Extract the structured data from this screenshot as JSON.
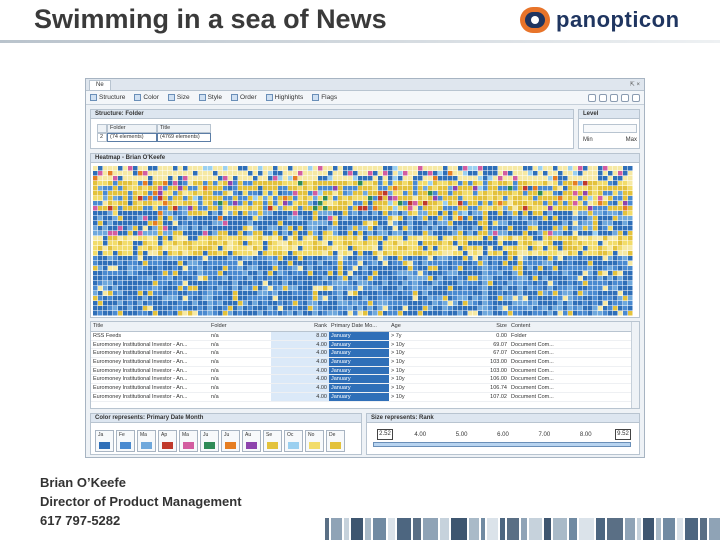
{
  "slide": {
    "title": "Swimming in a sea of News",
    "logo_text": "panopticon",
    "presenter": {
      "name": "Brian O’Keefe",
      "role": "Director of Product Management",
      "phone": "617 797-5282"
    }
  },
  "app": {
    "tab_label": "Ne",
    "window_controls": "⇱ ×",
    "toolbar": {
      "items": [
        {
          "label": "Structure",
          "icon": "structure-icon"
        },
        {
          "label": "Color",
          "icon": "color-icon"
        },
        {
          "label": "Size",
          "icon": "size-icon"
        },
        {
          "label": "Style",
          "icon": "style-icon"
        },
        {
          "label": "Order",
          "icon": "order-icon"
        },
        {
          "label": "Highlights",
          "icon": "highlights-icon"
        },
        {
          "label": "Flags",
          "icon": "flags-icon"
        }
      ]
    },
    "structure_panel": {
      "header": "Structure: Folder",
      "columns": [
        "Folder",
        "Title"
      ],
      "row_number": "2",
      "row_values": [
        "(74 elements)",
        "(4769 elements)"
      ]
    },
    "level_panel": {
      "header": "Level",
      "min_label": "Min",
      "max_label": "Max"
    },
    "heatmap_panel": {
      "header": "Heatmap - Brian O'Keefe",
      "colors": [
        "#2f6fb8",
        "#4a8ad0",
        "#e3c23c",
        "#f2dc6a",
        "#f6e9a4",
        "#6fa8dc",
        "#c0392b",
        "#2e8b57",
        "#8e44ad",
        "#e67e22",
        "#d35da0",
        "#9bd0f0"
      ]
    },
    "table": {
      "columns": [
        "Title",
        "Folder",
        "Rank",
        "Primary Date Mo...",
        "Age",
        "Size",
        "Content"
      ],
      "rows": [
        [
          "RSS Feeds",
          "n/a",
          "8.00",
          "January",
          "> 7y",
          "0.00",
          "Folder"
        ],
        [
          "Euromoney Institutional Investor - An...",
          "n/a",
          "4.00",
          "January",
          "> 10y",
          "69.07",
          "Document Com..."
        ],
        [
          "Euromoney Institutional Investor - An...",
          "n/a",
          "4.00",
          "January",
          "> 10y",
          "67.07",
          "Document Com..."
        ],
        [
          "Euromoney Institutional Investor - An...",
          "n/a",
          "4.00",
          "January",
          "> 10y",
          "103.00",
          "Document Com..."
        ],
        [
          "Euromoney Institutional Investor - An...",
          "n/a",
          "4.00",
          "January",
          "> 10y",
          "103.00",
          "Document Com..."
        ],
        [
          "Euromoney Institutional Investor - An...",
          "n/a",
          "4.00",
          "January",
          "> 10y",
          "106.00",
          "Document Com..."
        ],
        [
          "Euromoney Institutional Investor - An...",
          "n/a",
          "4.00",
          "January",
          "> 10y",
          "106.74",
          "Document Com..."
        ],
        [
          "Euromoney Institutional Investor - An...",
          "n/a",
          "4.00",
          "January",
          "> 10y",
          "107.02",
          "Document Com..."
        ]
      ]
    },
    "color_panel": {
      "header": "Color represents: Primary Date Month",
      "items": [
        {
          "label": "Ja",
          "color": "#2f6fb8"
        },
        {
          "label": "Fe",
          "color": "#4a8ad0"
        },
        {
          "label": "Ma",
          "color": "#6fa8dc"
        },
        {
          "label": "Ap",
          "color": "#c0392b"
        },
        {
          "label": "Ma",
          "color": "#d35da0"
        },
        {
          "label": "Ju",
          "color": "#2e8b57"
        },
        {
          "label": "Ju",
          "color": "#e67e22"
        },
        {
          "label": "Au",
          "color": "#8e44ad"
        },
        {
          "label": "Se",
          "color": "#e3c23c"
        },
        {
          "label": "Oc",
          "color": "#9bd0f0"
        },
        {
          "label": "No",
          "color": "#f2dc6a"
        },
        {
          "label": "De",
          "color": "#e3c23c"
        }
      ]
    },
    "size_panel": {
      "header": "Size represents: Rank",
      "min_handle": "2.52",
      "max_handle": "9.52",
      "ticks": [
        "2.52",
        "4.00",
        "5.00",
        "6.00",
        "7.00",
        "8.00",
        "9.52"
      ]
    }
  }
}
